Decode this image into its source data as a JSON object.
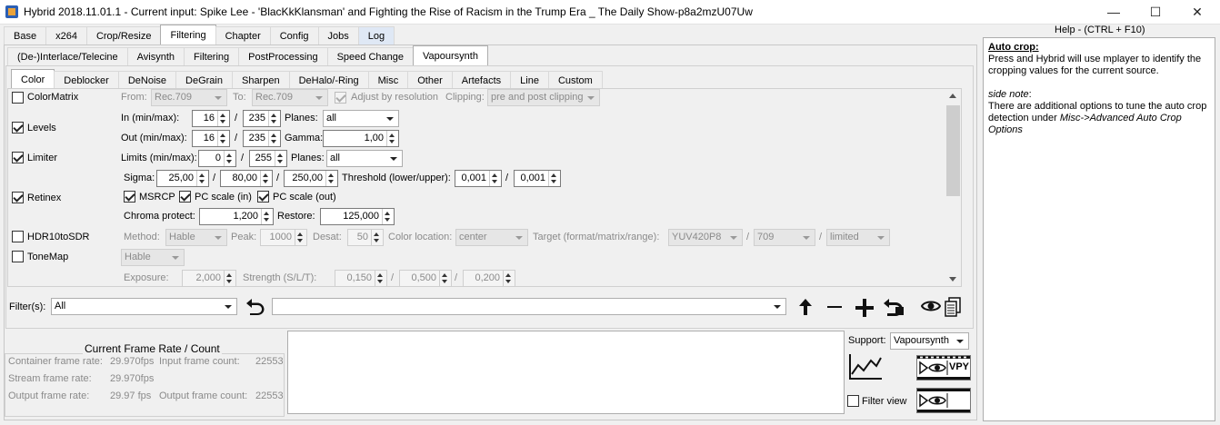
{
  "window": {
    "title": "Hybrid 2018.11.01.1 - Current input: Spike Lee - 'BlacKkKlansman' and Fighting the Rise of Racism in the Trump Era _ The Daily Show-p8a2mzU07Uw",
    "minimize": "—",
    "maximize": "☐",
    "close": "✕"
  },
  "main_tabs": [
    "Base",
    "x264",
    "Crop/Resize",
    "Filtering",
    "Chapter",
    "Config",
    "Jobs",
    "Log"
  ],
  "sub_tabs": [
    "(De-)Interlace/Telecine",
    "Avisynth",
    "Filtering",
    "PostProcessing",
    "Speed Change",
    "Vapoursynth"
  ],
  "inner_tabs": [
    "Color",
    "Deblocker",
    "DeNoise",
    "DeGrain",
    "Sharpen",
    "DeHalo/-Ring",
    "Misc",
    "Other",
    "Artefacts",
    "Line",
    "Custom"
  ],
  "colormatrix": {
    "label": "ColorMatrix",
    "from_label": "From:",
    "from_value": "Rec.709",
    "to_label": "To:",
    "to_value": "Rec.709",
    "adjust_label": "Adjust by resolution",
    "clipping_label": "Clipping:",
    "clipping_value": "pre and post clipping"
  },
  "levels": {
    "label": "Levels",
    "in_label": "In (min/max):",
    "in_min": "16",
    "in_max": "235",
    "planes_label": "Planes:",
    "planes_value": "all",
    "out_label": "Out (min/max):",
    "out_min": "16",
    "out_max": "235",
    "gamma_label": "Gamma:",
    "gamma_value": "1,00",
    "slash": "/"
  },
  "limiter": {
    "label": "Limiter",
    "limits_label": "Limits (min/max):",
    "min": "0",
    "max": "255",
    "planes_label": "Planes:",
    "planes_value": "all"
  },
  "retinex": {
    "label": "Retinex",
    "sigma_label": "Sigma:",
    "sigma1": "25,00",
    "sigma2": "80,00",
    "sigma3": "250,00",
    "threshold_label": "Threshold (lower/upper):",
    "thr_lower": "0,001",
    "thr_upper": "0,001",
    "msrcp": "MSRCP",
    "pc_in": "PC scale (in)",
    "pc_out": "PC scale (out)",
    "chroma_label": "Chroma protect:",
    "chroma_value": "1,200",
    "restore_label": "Restore:",
    "restore_value": "125,000"
  },
  "hdr": {
    "label": "HDR10toSDR",
    "method_label": "Method:",
    "method_value": "Hable",
    "peak_label": "Peak:",
    "peak_value": "1000",
    "desat_label": "Desat:",
    "desat_value": "50",
    "colorloc_label": "Color location:",
    "colorloc_value": "center",
    "target_label": "Target (format/matrix/range):",
    "target_format": "YUV420P8",
    "target_matrix": "709",
    "target_range": "limited"
  },
  "tonemap": {
    "label": "ToneMap",
    "method_value": "Hable",
    "exposure_label": "Exposure:",
    "exposure_value": "2,000",
    "strength_label": "Strength (S/L/T):",
    "s": "0,150",
    "l": "0,500",
    "t": "0,200"
  },
  "filters": {
    "label": "Filter(s):",
    "selected": "All",
    "chain_value": ""
  },
  "framerate": {
    "title": "Current Frame Rate / Count",
    "container_label": "Container frame rate:",
    "container_value": "29.970fps",
    "input_count_label": "Input frame count:",
    "input_count_value": "22553",
    "stream_label": "Stream frame rate:",
    "stream_value": "29.970fps",
    "output_label": "Output frame rate:",
    "output_value": "29.97 fps",
    "output_count_label": "Output frame count:",
    "output_count_value": "22553"
  },
  "support": {
    "label": "Support:",
    "value": "Vapoursynth",
    "filter_view_label": "Filter view",
    "vpy_label": "VPY"
  },
  "help": {
    "title": "Help - (CTRL + F10)",
    "heading": "Auto crop:",
    "text1": "Press and Hybrid will use mplayer to identify the cropping values for the current source.",
    "side_note": "side note",
    "colon": ":",
    "text2": "There are additional options to tune the auto crop detection under ",
    "link": "Misc->Advanced Auto Crop Options"
  }
}
